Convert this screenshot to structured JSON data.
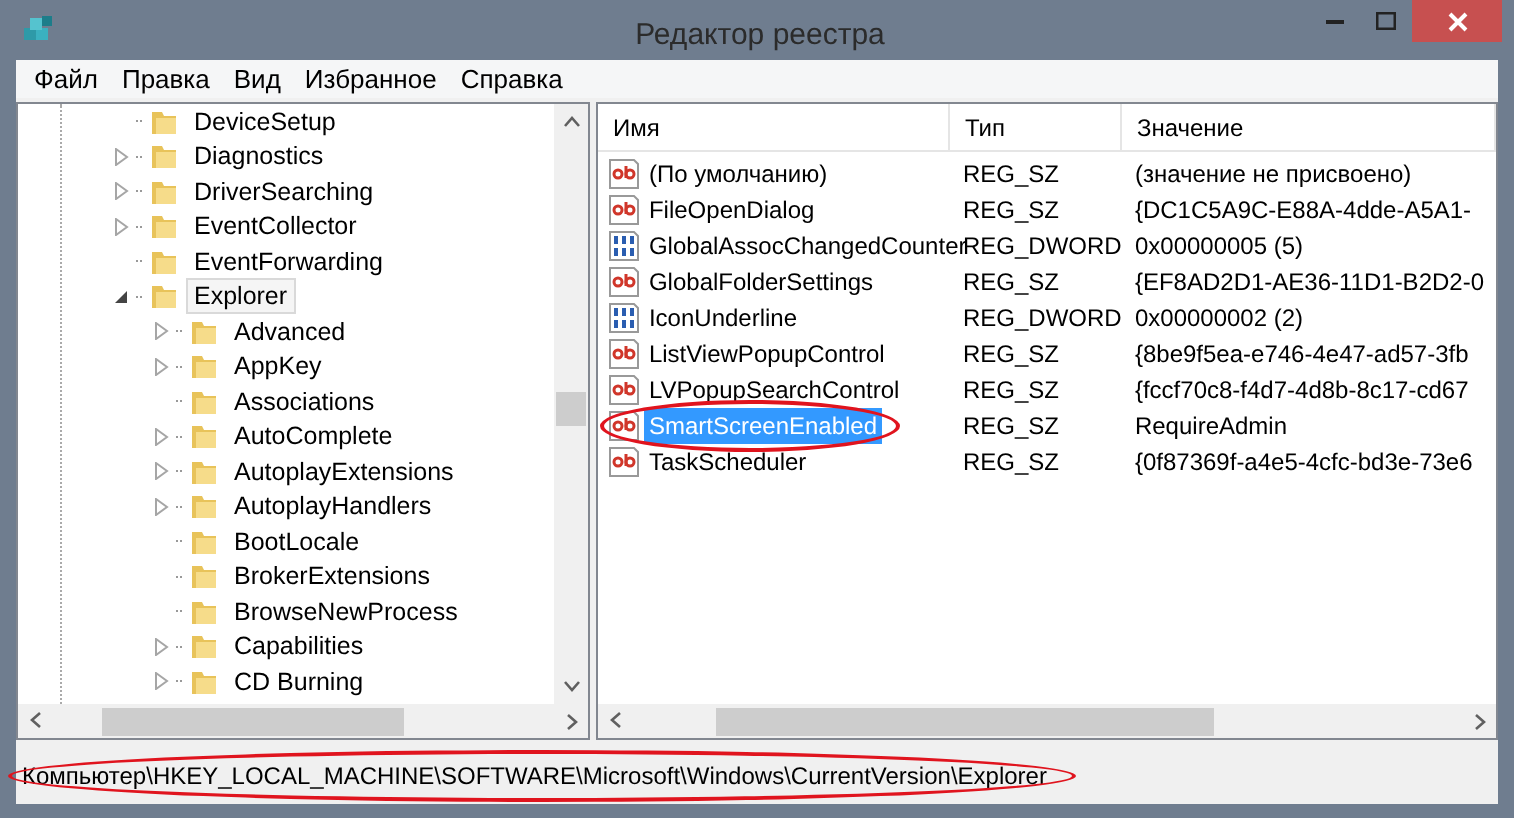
{
  "window": {
    "title": "Редактор реестра"
  },
  "menu": [
    "Файл",
    "Правка",
    "Вид",
    "Избранное",
    "Справка"
  ],
  "tree": [
    {
      "label": "DeviceSetup",
      "has_children": false,
      "selected": false
    },
    {
      "label": "Diagnostics",
      "has_children": true,
      "expanded": false,
      "selected": false
    },
    {
      "label": "DriverSearching",
      "has_children": true,
      "expanded": false,
      "selected": false
    },
    {
      "label": "EventCollector",
      "has_children": true,
      "expanded": false,
      "selected": false
    },
    {
      "label": "EventForwarding",
      "has_children": false,
      "selected": false
    },
    {
      "label": "Explorer",
      "has_children": true,
      "expanded": true,
      "selected": true,
      "children": [
        {
          "label": "Advanced",
          "has_children": true,
          "expanded": false,
          "selected": false
        },
        {
          "label": "AppKey",
          "has_children": true,
          "expanded": false,
          "selected": false
        },
        {
          "label": "Associations",
          "has_children": false,
          "selected": false
        },
        {
          "label": "AutoComplete",
          "has_children": true,
          "expanded": false,
          "selected": false
        },
        {
          "label": "AutoplayExtensions",
          "has_children": true,
          "expanded": false,
          "selected": false
        },
        {
          "label": "AutoplayHandlers",
          "has_children": true,
          "expanded": false,
          "selected": false
        },
        {
          "label": "BootLocale",
          "has_children": false,
          "selected": false
        },
        {
          "label": "BrokerExtensions",
          "has_children": false,
          "selected": false
        },
        {
          "label": "BrowseNewProcess",
          "has_children": false,
          "selected": false
        },
        {
          "label": "Capabilities",
          "has_children": true,
          "expanded": false,
          "selected": false
        },
        {
          "label": "CD Burning",
          "has_children": true,
          "expanded": false,
          "selected": false
        }
      ]
    }
  ],
  "table": {
    "columns": [
      "Имя",
      "Тип",
      "Значение"
    ],
    "rows": [
      {
        "kind": "string",
        "name": "(По умолчанию)",
        "type": "REG_SZ",
        "value": "(значение не присвоено)",
        "selected": false,
        "circled": false
      },
      {
        "kind": "string",
        "name": "FileOpenDialog",
        "type": "REG_SZ",
        "value": "{DC1C5A9C-E88A-4dde-A5A1-",
        "selected": false,
        "circled": false
      },
      {
        "kind": "dword",
        "name": "GlobalAssocChangedCounter",
        "type": "REG_DWORD",
        "value": "0x00000005 (5)",
        "selected": false,
        "circled": false
      },
      {
        "kind": "string",
        "name": "GlobalFolderSettings",
        "type": "REG_SZ",
        "value": "{EF8AD2D1-AE36-11D1-B2D2-0",
        "selected": false,
        "circled": false
      },
      {
        "kind": "dword",
        "name": "IconUnderline",
        "type": "REG_DWORD",
        "value": "0x00000002 (2)",
        "selected": false,
        "circled": false
      },
      {
        "kind": "string",
        "name": "ListViewPopupControl",
        "type": "REG_SZ",
        "value": "{8be9f5ea-e746-4e47-ad57-3fb",
        "selected": false,
        "circled": false
      },
      {
        "kind": "string",
        "name": "LVPopupSearchControl",
        "type": "REG_SZ",
        "value": "{fccf70c8-f4d7-4d8b-8c17-cd67",
        "selected": false,
        "circled": false
      },
      {
        "kind": "string",
        "name": "SmartScreenEnabled",
        "type": "REG_SZ",
        "value": "RequireAdmin",
        "selected": true,
        "circled": true
      },
      {
        "kind": "string",
        "name": "TaskScheduler",
        "type": "REG_SZ",
        "value": "{0f87369f-a4e5-4cfc-bd3e-73e6",
        "selected": false,
        "circled": false
      }
    ]
  },
  "status_bar": {
    "path": "Компьютер\\HKEY_LOCAL_MACHINE\\SOFTWARE\\Microsoft\\Windows\\CurrentVersion\\Explorer",
    "circled": true
  }
}
